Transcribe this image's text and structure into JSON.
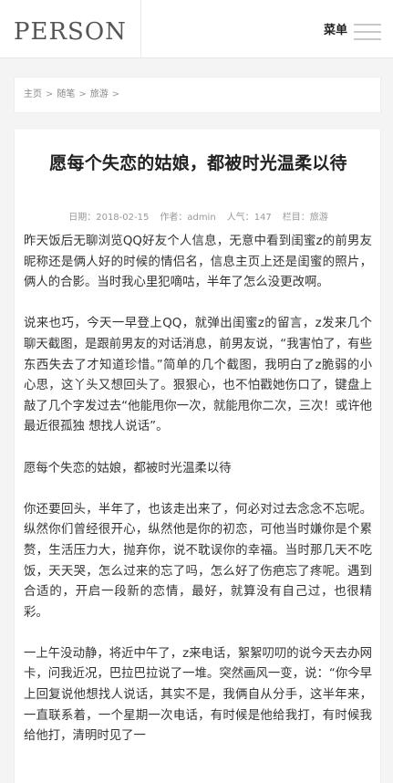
{
  "header": {
    "logo": "PERSON",
    "menu_label": "菜单"
  },
  "breadcrumb": {
    "items": [
      "主页",
      "随笔",
      "旅游"
    ],
    "separator": ">"
  },
  "article": {
    "title": "愿每个失恋的姑娘，都被时光温柔以待",
    "meta": {
      "date_label": "日期：",
      "date": "2018-02-15",
      "author_label": "作者：",
      "author": "admin",
      "views_label": "人气：",
      "views": "147",
      "category_label": "栏目：",
      "category": "旅游"
    },
    "paragraphs": [
      "昨天饭后无聊浏览QQ好友个人信息，无意中看到闺蜜z的前男友昵称还是俩人好的时候的情侣名，信息主页上还是闺蜜的照片，俩人的合影。当时我心里犯嘀咕，半年了怎么没更改啊。",
      "说来也巧，今天一早登上QQ，就弹出闺蜜z的留言，z发来几个聊天截图，是跟前男友的对话消息，前男友说，“我害怕了，有些东西失去了才知道珍惜。”简单的几个截图，我明白了z脆弱的小心思，这丫头又想回头了。狠狠心，也不怕戳她伤口了，键盘上敲了几个字发过去“他能甩你一次，就能甩你二次，三次！或许他最近很孤独 想找人说话”。",
      "愿每个失恋的姑娘，都被时光温柔以待",
      "你还要回头，半年了，也该走出来了，何必对过去念念不忘呢。纵然你们曾经很开心，纵然他是你的初恋，可他当时嫌你是个累赘，生活压力大，抛弃你，说不耽误你的幸福。当时那几天不吃饭，天天哭，怎么过来的忘了吗，怎么好了伤疤忘了疼呢。遇到合适的，开启一段新的恋情，最好，就算没有自己过，也很精彩。",
      "一上午没动静，将近中午了，z来电话，絮絮叨叨的说今天去办网卡，问我近况，巴拉巴拉说了一堆。突然画风一变，说：“你今早上回复说他想找人说话，其实不是，我俩自从分手，这半年来，一直联系着，一个星期一次电话，有时候是他给我打，有时候我给他打，清明时见了一"
    ]
  }
}
